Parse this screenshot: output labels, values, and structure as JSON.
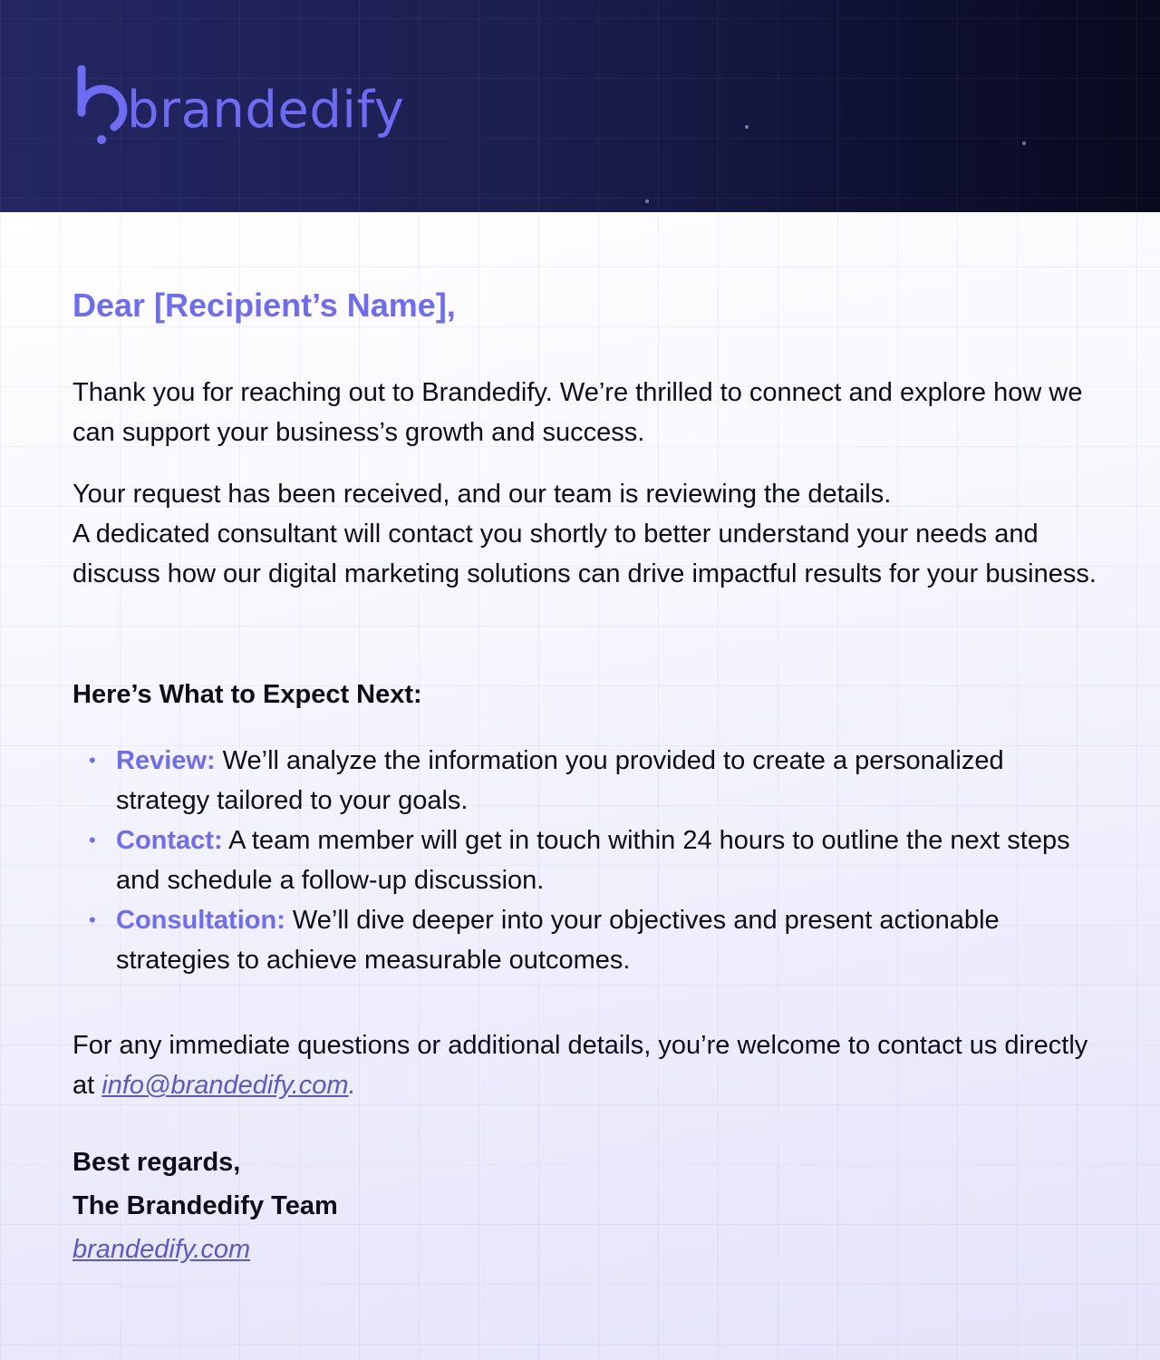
{
  "header": {
    "brand_name": "brandedify",
    "logo_icon": "brandedify-logo-icon",
    "background_color": "#1c1f50",
    "brand_color": "#6f6cf4"
  },
  "letter": {
    "greeting": "Dear [Recipient’s Name],",
    "intro_paragraph": "Thank you for reaching out to Brandedify. We’re thrilled to connect and explore how we can support your business’s growth and success.",
    "status_line": "Your request has been received, and our team is reviewing the details.",
    "consultant_paragraph": "A dedicated consultant will contact you shortly to better understand your needs and discuss how our digital marketing solutions can drive impactful results for your business.",
    "next_steps_heading": "Here’s What to Expect Next:",
    "steps": [
      {
        "label": "Review:",
        "text": "We’ll analyze the information you provided to create a personalized strategy tailored to your goals."
      },
      {
        "label": "Contact:",
        "text": "A team member will get in touch within 24 hours to outline the next steps and schedule a follow-up discussion."
      },
      {
        "label": "Consultation:",
        "text": "We’ll dive deeper into your objectives and present actionable strategies to achieve measurable outcomes."
      }
    ],
    "contact_paragraph": "For any immediate questions or additional details, you’re welcome to contact us directly at",
    "contact_email": "info@brandedify.com",
    "contact_email_suffix": ".",
    "closing": "Best regards,",
    "team_signature": "The Brandedify Team",
    "website_link": "brandedify.com"
  }
}
